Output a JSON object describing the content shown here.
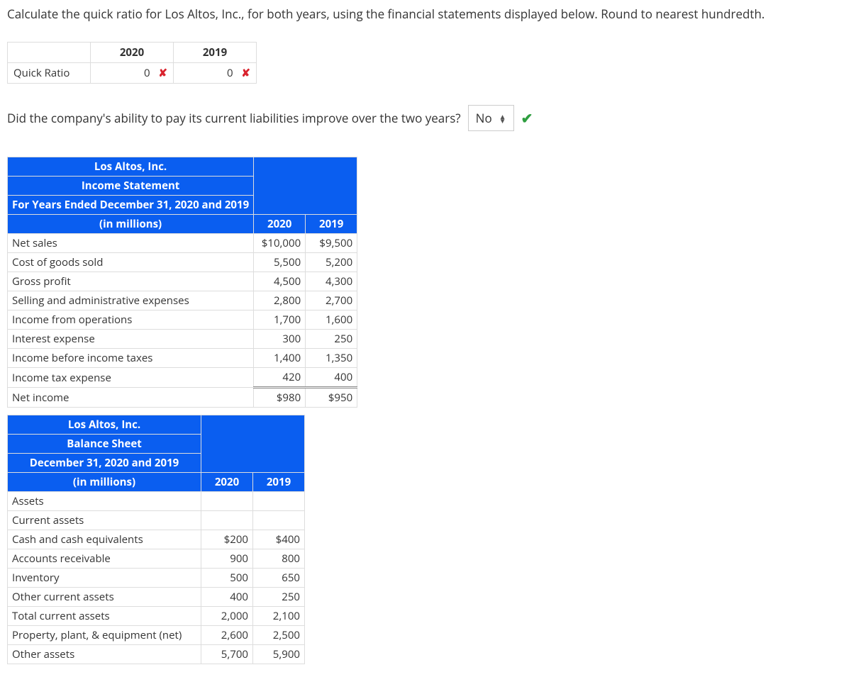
{
  "question_main": "Calculate the quick ratio for Los Altos, Inc., for both years, using the financial statements displayed below. Round to nearest hundredth.",
  "answer_table": {
    "row_label": "Quick Ratio",
    "cols": [
      "2020",
      "2019"
    ],
    "values": {
      "2020": "0",
      "2019": "0"
    },
    "marks": {
      "2020": "wrong",
      "2019": "wrong"
    }
  },
  "question_improve": "Did the company's ability to pay its current liabilities improve over the two years?",
  "improve_select": {
    "value": "No",
    "mark": "correct"
  },
  "income_statement": {
    "title_lines": [
      "Los Altos, Inc.",
      "Income Statement",
      "For Years Ended December 31, 2020 and 2019",
      "(in millions)"
    ],
    "year_cols": [
      "2020",
      "2019"
    ],
    "rows": [
      {
        "label": "Net sales",
        "v2020": "$10,000",
        "v2019": "$9,500"
      },
      {
        "label": "Cost of goods sold",
        "v2020": "5,500",
        "v2019": "5,200"
      },
      {
        "label": "Gross profit",
        "v2020": "4,500",
        "v2019": "4,300"
      },
      {
        "label": "Selling and administrative expenses",
        "v2020": "2,800",
        "v2019": "2,700"
      },
      {
        "label": "Income from operations",
        "v2020": "1,700",
        "v2019": "1,600"
      },
      {
        "label": "Interest expense",
        "v2020": "300",
        "v2019": "250"
      },
      {
        "label": "Income before income taxes",
        "v2020": "1,400",
        "v2019": "1,350"
      },
      {
        "label": "Income tax expense",
        "v2020": "420",
        "v2019": "400"
      },
      {
        "label": "Net income",
        "v2020": "$980",
        "v2019": "$950",
        "total": true
      }
    ]
  },
  "balance_sheet": {
    "title_lines": [
      "Los Altos, Inc.",
      "Balance Sheet",
      "December 31, 2020 and 2019",
      "(in millions)"
    ],
    "year_cols": [
      "2020",
      "2019"
    ],
    "rows": [
      {
        "label": "Assets",
        "v2020": "",
        "v2019": ""
      },
      {
        "label": "Current assets",
        "v2020": "",
        "v2019": ""
      },
      {
        "label": "Cash and cash equivalents",
        "v2020": "$200",
        "v2019": "$400"
      },
      {
        "label": "Accounts receivable",
        "v2020": "900",
        "v2019": "800"
      },
      {
        "label": "Inventory",
        "v2020": "500",
        "v2019": "650"
      },
      {
        "label": "Other current assets",
        "v2020": "400",
        "v2019": "250"
      },
      {
        "label": "Total current assets",
        "v2020": "2,000",
        "v2019": "2,100"
      },
      {
        "label": "Property, plant, & equipment (net)",
        "v2020": "2,600",
        "v2019": "2,500"
      },
      {
        "label": "Other assets",
        "v2020": "5,700",
        "v2019": "5,900"
      }
    ]
  }
}
